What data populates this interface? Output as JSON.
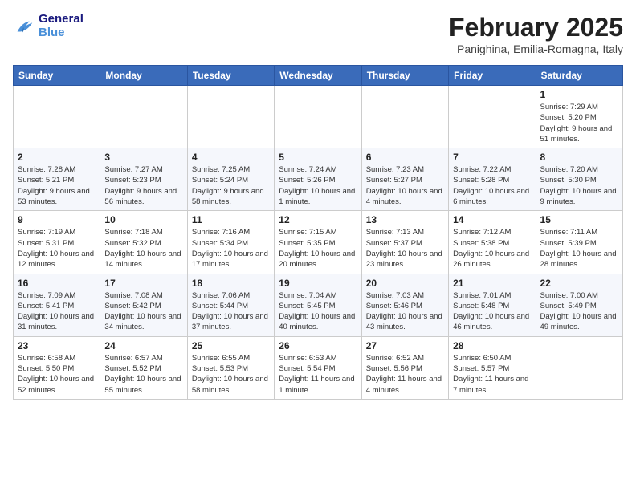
{
  "logo": {
    "line1": "General",
    "line2": "Blue"
  },
  "header": {
    "month": "February 2025",
    "location": "Panighina, Emilia-Romagna, Italy"
  },
  "weekdays": [
    "Sunday",
    "Monday",
    "Tuesday",
    "Wednesday",
    "Thursday",
    "Friday",
    "Saturday"
  ],
  "weeks": [
    [
      {
        "day": "",
        "info": ""
      },
      {
        "day": "",
        "info": ""
      },
      {
        "day": "",
        "info": ""
      },
      {
        "day": "",
        "info": ""
      },
      {
        "day": "",
        "info": ""
      },
      {
        "day": "",
        "info": ""
      },
      {
        "day": "1",
        "info": "Sunrise: 7:29 AM\nSunset: 5:20 PM\nDaylight: 9 hours and 51 minutes."
      }
    ],
    [
      {
        "day": "2",
        "info": "Sunrise: 7:28 AM\nSunset: 5:21 PM\nDaylight: 9 hours and 53 minutes."
      },
      {
        "day": "3",
        "info": "Sunrise: 7:27 AM\nSunset: 5:23 PM\nDaylight: 9 hours and 56 minutes."
      },
      {
        "day": "4",
        "info": "Sunrise: 7:25 AM\nSunset: 5:24 PM\nDaylight: 9 hours and 58 minutes."
      },
      {
        "day": "5",
        "info": "Sunrise: 7:24 AM\nSunset: 5:26 PM\nDaylight: 10 hours and 1 minute."
      },
      {
        "day": "6",
        "info": "Sunrise: 7:23 AM\nSunset: 5:27 PM\nDaylight: 10 hours and 4 minutes."
      },
      {
        "day": "7",
        "info": "Sunrise: 7:22 AM\nSunset: 5:28 PM\nDaylight: 10 hours and 6 minutes."
      },
      {
        "day": "8",
        "info": "Sunrise: 7:20 AM\nSunset: 5:30 PM\nDaylight: 10 hours and 9 minutes."
      }
    ],
    [
      {
        "day": "9",
        "info": "Sunrise: 7:19 AM\nSunset: 5:31 PM\nDaylight: 10 hours and 12 minutes."
      },
      {
        "day": "10",
        "info": "Sunrise: 7:18 AM\nSunset: 5:32 PM\nDaylight: 10 hours and 14 minutes."
      },
      {
        "day": "11",
        "info": "Sunrise: 7:16 AM\nSunset: 5:34 PM\nDaylight: 10 hours and 17 minutes."
      },
      {
        "day": "12",
        "info": "Sunrise: 7:15 AM\nSunset: 5:35 PM\nDaylight: 10 hours and 20 minutes."
      },
      {
        "day": "13",
        "info": "Sunrise: 7:13 AM\nSunset: 5:37 PM\nDaylight: 10 hours and 23 minutes."
      },
      {
        "day": "14",
        "info": "Sunrise: 7:12 AM\nSunset: 5:38 PM\nDaylight: 10 hours and 26 minutes."
      },
      {
        "day": "15",
        "info": "Sunrise: 7:11 AM\nSunset: 5:39 PM\nDaylight: 10 hours and 28 minutes."
      }
    ],
    [
      {
        "day": "16",
        "info": "Sunrise: 7:09 AM\nSunset: 5:41 PM\nDaylight: 10 hours and 31 minutes."
      },
      {
        "day": "17",
        "info": "Sunrise: 7:08 AM\nSunset: 5:42 PM\nDaylight: 10 hours and 34 minutes."
      },
      {
        "day": "18",
        "info": "Sunrise: 7:06 AM\nSunset: 5:44 PM\nDaylight: 10 hours and 37 minutes."
      },
      {
        "day": "19",
        "info": "Sunrise: 7:04 AM\nSunset: 5:45 PM\nDaylight: 10 hours and 40 minutes."
      },
      {
        "day": "20",
        "info": "Sunrise: 7:03 AM\nSunset: 5:46 PM\nDaylight: 10 hours and 43 minutes."
      },
      {
        "day": "21",
        "info": "Sunrise: 7:01 AM\nSunset: 5:48 PM\nDaylight: 10 hours and 46 minutes."
      },
      {
        "day": "22",
        "info": "Sunrise: 7:00 AM\nSunset: 5:49 PM\nDaylight: 10 hours and 49 minutes."
      }
    ],
    [
      {
        "day": "23",
        "info": "Sunrise: 6:58 AM\nSunset: 5:50 PM\nDaylight: 10 hours and 52 minutes."
      },
      {
        "day": "24",
        "info": "Sunrise: 6:57 AM\nSunset: 5:52 PM\nDaylight: 10 hours and 55 minutes."
      },
      {
        "day": "25",
        "info": "Sunrise: 6:55 AM\nSunset: 5:53 PM\nDaylight: 10 hours and 58 minutes."
      },
      {
        "day": "26",
        "info": "Sunrise: 6:53 AM\nSunset: 5:54 PM\nDaylight: 11 hours and 1 minute."
      },
      {
        "day": "27",
        "info": "Sunrise: 6:52 AM\nSunset: 5:56 PM\nDaylight: 11 hours and 4 minutes."
      },
      {
        "day": "28",
        "info": "Sunrise: 6:50 AM\nSunset: 5:57 PM\nDaylight: 11 hours and 7 minutes."
      },
      {
        "day": "",
        "info": ""
      }
    ]
  ]
}
